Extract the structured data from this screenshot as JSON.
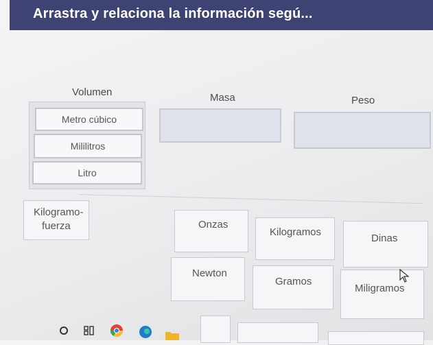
{
  "header": {
    "title": "Arrastra y relaciona la información segú..."
  },
  "columns": {
    "volumen": "Volumen",
    "masa": "Masa",
    "peso": "Peso"
  },
  "volumen_items": [
    "Metro cúbico",
    "Mililitros",
    "Litro"
  ],
  "cards": {
    "kilogramo_fuerza_line1": "Kilogramo-",
    "kilogramo_fuerza_line2": "fuerza",
    "onzas": "Onzas",
    "kilogramos": "Kilogramos",
    "dinas": "Dinas",
    "newton": "Newton",
    "gramos": "Gramos",
    "miligramos": "Miligramos"
  },
  "colors": {
    "header_bg": "#3f4373",
    "drop_zone": "#dfe2ea",
    "card_bg": "#f6f6f8"
  },
  "taskbar": {
    "icons": [
      "search-circle-icon",
      "task-view-icon",
      "chrome-icon",
      "edge-icon",
      "folder-icon"
    ]
  }
}
